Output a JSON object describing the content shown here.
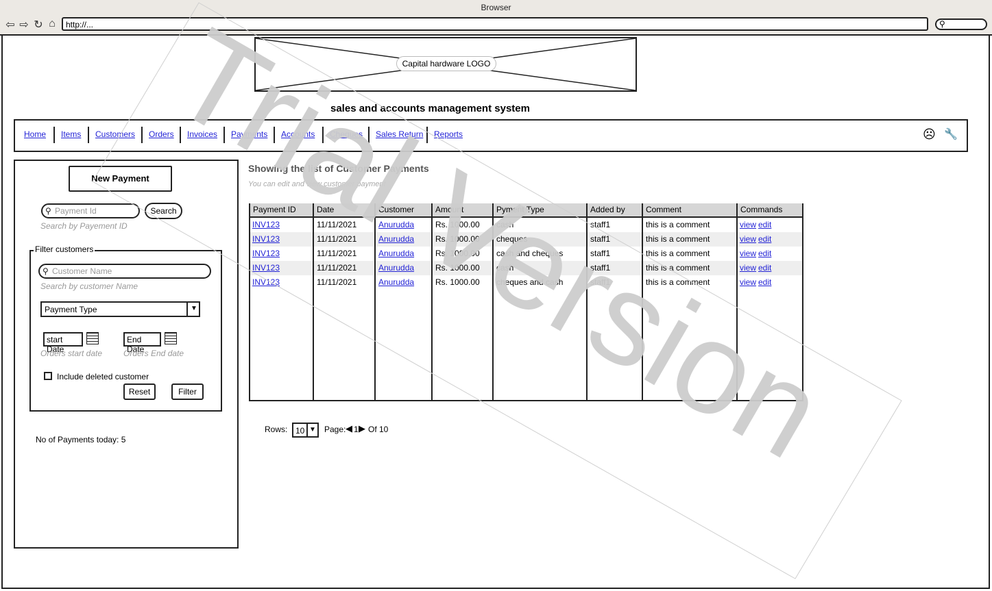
{
  "browser": {
    "title": "Browser",
    "url": "http://...",
    "nav_icons": [
      "back-icon",
      "forward-icon",
      "reload-icon",
      "home-icon"
    ]
  },
  "logo": {
    "label": "Capital hardware LOGO"
  },
  "app_title": "sales and accounts management system",
  "nav": {
    "items": [
      "Home",
      "Items",
      "Customers",
      "Orders",
      "Invoices",
      "Payments",
      "Accounts",
      "Cheques",
      "Sales Return",
      "Reports"
    ],
    "user_icon": "sad-face-icon",
    "settings_icon": "wrench-icon"
  },
  "sidebar": {
    "new_payment_label": "New Payment",
    "payment_id_placeholder": "Payment Id",
    "search_label": "Search",
    "payment_id_hint": "Search by Payement ID",
    "filter": {
      "legend": "Filter customers",
      "customer_placeholder": "Customer Name",
      "customer_hint": "Search by customer Name",
      "payment_type_label": "Payment Type",
      "start_date_label": "start Date",
      "start_date_hint": "Orders start date",
      "end_date_label": "End Date",
      "end_date_hint": "Orders End date",
      "include_deleted_label": "Include deleted customer",
      "reset_label": "Reset",
      "filter_label": "Filter"
    },
    "payments_today": "No of Payments today: 5"
  },
  "main": {
    "title": "Showing the list of Customer Payments",
    "subtitle": "You can edit and view customer payment",
    "table": {
      "columns": [
        "Payment ID",
        "Date",
        "Customer",
        "Amount",
        "Pyment Type",
        "Added by",
        "Comment",
        "Commands"
      ],
      "rows": [
        {
          "id": "INV123",
          "date": "11/11/2021",
          "customer": "Anurudda",
          "amount": "Rs. 1000.00",
          "type": "cash",
          "added_by": "staff1",
          "comment": "this is a comment",
          "view": "view",
          "edit": "edit"
        },
        {
          "id": "INV123",
          "date": "11/11/2021",
          "customer": "Anurudda",
          "amount": "Rs. 1000.00",
          "type": "cheques",
          "added_by": "staff1",
          "comment": "this is a comment",
          "view": "view",
          "edit": "edit"
        },
        {
          "id": "INV123",
          "date": "11/11/2021",
          "customer": "Anurudda",
          "amount": "Rs. 1000.00",
          "type": "cash and cheques",
          "added_by": "staff1",
          "comment": "this is a comment",
          "view": "view",
          "edit": "edit"
        },
        {
          "id": "INV123",
          "date": "11/11/2021",
          "customer": "Anurudda",
          "amount": "Rs. 1000.00",
          "type": "cash",
          "added_by": "staff1",
          "comment": "this is a comment",
          "view": "view",
          "edit": "edit"
        },
        {
          "id": "INV123",
          "date": "11/11/2021",
          "customer": "Anurudda",
          "amount": "Rs. 1000.00",
          "type": "cheques and cash",
          "added_by": "staff1",
          "comment": "this is a comment",
          "view": "view",
          "edit": "edit"
        }
      ]
    },
    "pager": {
      "rows_label": "Rows:",
      "rows_value": "10",
      "page_label": "Page:",
      "page_value": "1",
      "of_label": "Of 10"
    }
  },
  "watermark": "Trial Version",
  "colors": {
    "link": "#2323d6",
    "header_bg": "#d6d6d6",
    "hint": "#999999"
  }
}
